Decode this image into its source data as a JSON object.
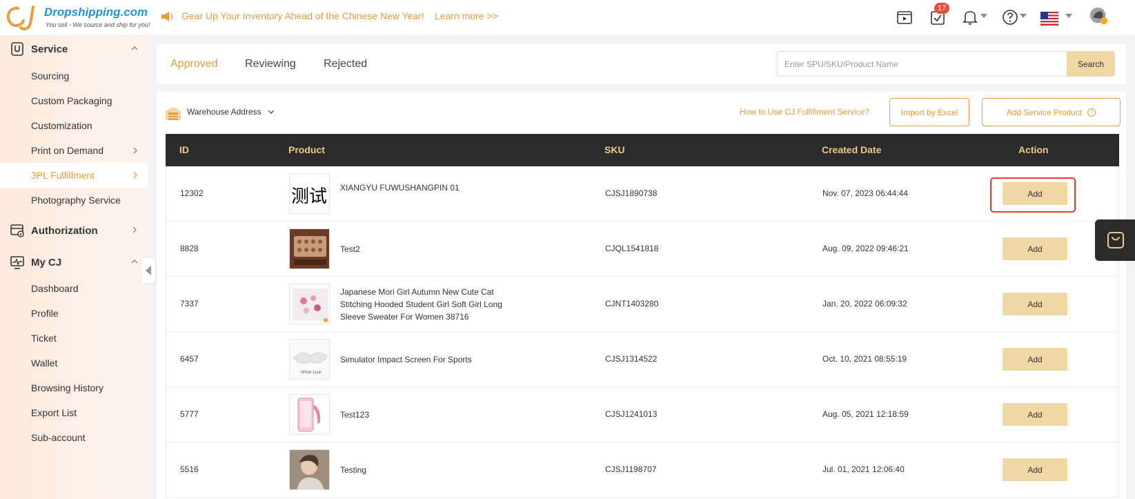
{
  "header": {
    "brand": "Dropshipping.com",
    "tagline": "You sell - We source and ship for you!",
    "announcement": "Gear Up Your Inventory Ahead of the Chinese New Year!",
    "learn_more": "Learn more >>",
    "task_badge": "17",
    "icons": [
      "video-icon",
      "task-check-icon",
      "bell-icon",
      "help-icon",
      "us-flag-icon",
      "avatar"
    ]
  },
  "sidebar": {
    "sections": [
      {
        "label": "Service",
        "icon": "service-icon",
        "expanded": true,
        "items": [
          {
            "label": "Sourcing",
            "has_children": false
          },
          {
            "label": "Custom Packaging",
            "has_children": false
          },
          {
            "label": "Customization",
            "has_children": false
          },
          {
            "label": "Print on Demand",
            "has_children": true
          },
          {
            "label": "3PL Fulfillment",
            "has_children": true,
            "active": true
          },
          {
            "label": "Photography Service",
            "has_children": false
          }
        ]
      },
      {
        "label": "Authorization",
        "icon": "authorization-icon",
        "expanded": false,
        "items": []
      },
      {
        "label": "My CJ",
        "icon": "mycj-icon",
        "expanded": true,
        "items": [
          {
            "label": "Dashboard"
          },
          {
            "label": "Profile"
          },
          {
            "label": "Ticket"
          },
          {
            "label": "Wallet"
          },
          {
            "label": "Browsing History"
          },
          {
            "label": "Export List"
          },
          {
            "label": "Sub-account"
          }
        ]
      }
    ]
  },
  "tabs": [
    {
      "label": "Approved",
      "active": true
    },
    {
      "label": "Reviewing",
      "active": false
    },
    {
      "label": "Rejected",
      "active": false
    }
  ],
  "search": {
    "placeholder": "Enter SPU/SKU/Product Name",
    "value": "",
    "button": "Search"
  },
  "toolbar": {
    "warehouse_label": "Warehouse Address",
    "howto_link": "How to Use CJ Fulfillment Service?",
    "import_button": "Import by Excel",
    "add_service_button": "Add Service Product"
  },
  "table": {
    "columns": [
      "ID",
      "Product",
      "SKU",
      "Created Date",
      "Action"
    ],
    "rows": [
      {
        "id": "12302",
        "product": "XIANGYU FUWUSHANGPIN 01",
        "thumb_text": "测试",
        "sku": "CJSJ1890738",
        "date": "Nov. 07, 2023 06:44:44",
        "action": "Add",
        "highlighted": true
      },
      {
        "id": "8828",
        "product": "Test2",
        "sku": "CJQL1541818",
        "date": "Aug. 09, 2022 09:46:21",
        "action": "Add"
      },
      {
        "id": "7337",
        "product": "Japanese Mori Girl Autumn New Cute Cat Stitching Hooded Student Girl Soft Girl Long Sleeve Sweater For Women 38716",
        "sku": "CJNT1403280",
        "date": "Jan. 20, 2022 06:09:32",
        "action": "Add"
      },
      {
        "id": "6457",
        "product": "Simulator Impact Screen For Sports",
        "thumb_text": "White 1pair",
        "sku": "CJSJ1314522",
        "date": "Oct. 10, 2021 08:55:19",
        "action": "Add"
      },
      {
        "id": "5777",
        "product": "Test123",
        "sku": "CJSJ1241013",
        "date": "Aug. 05, 2021 12:18:59",
        "action": "Add"
      },
      {
        "id": "5516",
        "product": "Testing",
        "sku": "CJSJ1198707",
        "date": "Jul. 01, 2021 12:06:40",
        "action": "Add"
      }
    ]
  },
  "colors": {
    "accent": "#e89b3f",
    "button_fill": "#f0d8a4",
    "table_header": "#2b2b2b",
    "highlight": "#e53935"
  }
}
